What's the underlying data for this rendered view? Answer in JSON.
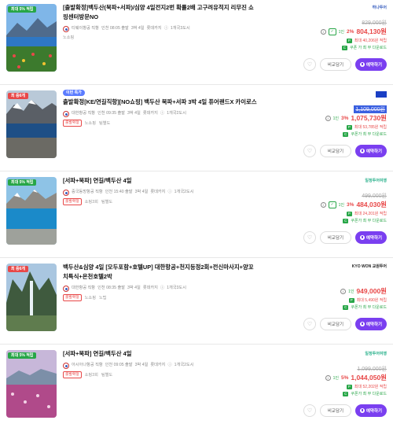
{
  "colors": {
    "accent": "#7a3ff0",
    "discount": "#e84848",
    "green": "#27a647",
    "special_pill": "#5b7cff"
  },
  "buttons": {
    "compare": "비교담기",
    "book": "예약하기"
  },
  "cards": [
    {
      "corner_badge": "최대 5% 적립",
      "corner_badge_color": "green",
      "pill": "",
      "title": "[출발확정]백두산(북파+서파)/심양 4일전지2번 확률2배 고구려유적지 리무진 쇼핑센터방문NO",
      "airline": "티웨이항공 직항",
      "schedule": "인천 08:05 출발",
      "duration": "3박 4일",
      "package": "롯데카지",
      "lodging": "1개국3도시",
      "tag_confirm": "",
      "tag_shop": "노쇼핑",
      "tag_guide": "",
      "agency_logo": "하나투어",
      "orig_price": "829,000원",
      "one_person": "1인",
      "disc_rate": "2%",
      "price": "804,130원",
      "points": "최대 40,206원 적립",
      "coupon": "쿠폰 가 최 무 다운로드"
    },
    {
      "corner_badge": "최 중6개",
      "corner_badge_color": "red",
      "pill": "이번 특가",
      "title": "출발확정[KE/연길직항][NO쇼핑] 백두산 북파+서파 3박 4일 퓨어랜드X 카이로스",
      "airline": "대한항공 직항",
      "schedule": "인천 09:35 출발",
      "duration": "3박 4일",
      "package": "롯데카지",
      "lodging": "1개국2도시",
      "tag_confirm": "출발확정",
      "tag_shop": "노쇼핑",
      "tag_guide": "팀별도",
      "agency_logo": "",
      "orig_price": "1,109,000원",
      "one_person": "1인",
      "disc_rate": "3%",
      "price": "1,075,730원",
      "points": "최대 53,785원 적립",
      "coupon": "쿠폰가 최 무 다운로드"
    },
    {
      "corner_badge": "최대 5% 적립",
      "corner_badge_color": "green",
      "pill": "",
      "title": "[서파+북파] 연길/백두산 4일",
      "airline": "중국동방항공 직항",
      "schedule": "인천 15:40 출발",
      "duration": "3박 4일",
      "package": "롯데카지",
      "lodging": "1개국2도시",
      "tag_confirm": "출발확정",
      "tag_shop": "쇼핑3회",
      "tag_guide": "팀별도",
      "agency_logo": "일정투어여행",
      "orig_price": "499,000원",
      "one_person": "1인",
      "disc_rate": "3%",
      "price": "484,030원",
      "points": "최대 24,201원 적립",
      "coupon": "쿠폰가 최 무 다운로드"
    },
    {
      "corner_badge": "최 중6개",
      "corner_badge_color": "red",
      "pill": "",
      "title": "백두산&심양 4일 [모두포함+호텔UP] 대한항공+천지등정2회+전신마사지+양꼬치특식+온천호텔2박",
      "airline": "대한항공 직항",
      "schedule": "인천 08:35 출발",
      "duration": "3박 4일",
      "package": "롯데카지",
      "lodging": "1개국3도시",
      "tag_confirm": "출발확정",
      "tag_shop": "노쇼핑",
      "tag_guide": "노팁",
      "agency_logo": "KYO WON 교원투어",
      "orig_price": "",
      "one_person": "1인",
      "disc_rate": "",
      "price": "949,000원",
      "points": "최대 5,490원 적립",
      "coupon": "쿠폰가 최 무 다운로드"
    },
    {
      "corner_badge": "최대 5% 적립",
      "corner_badge_color": "green",
      "pill": "",
      "title": "[서파+북파] 연길/백두산 4일",
      "airline": "아시아나항공 직항",
      "schedule": "인천 09:05 출발",
      "duration": "3박 4일",
      "package": "롯데카지",
      "lodging": "1개국2도시",
      "tag_confirm": "출발확정",
      "tag_shop": "쇼핑3회",
      "tag_guide": "팀별도",
      "agency_logo": "일정투어여행",
      "orig_price": "1,099,000원",
      "one_person": "1인",
      "disc_rate": "5%",
      "price": "1,044,050원",
      "points": "최대 52,202원 적립",
      "coupon": "쿠폰가 최 무 다운로드"
    }
  ]
}
